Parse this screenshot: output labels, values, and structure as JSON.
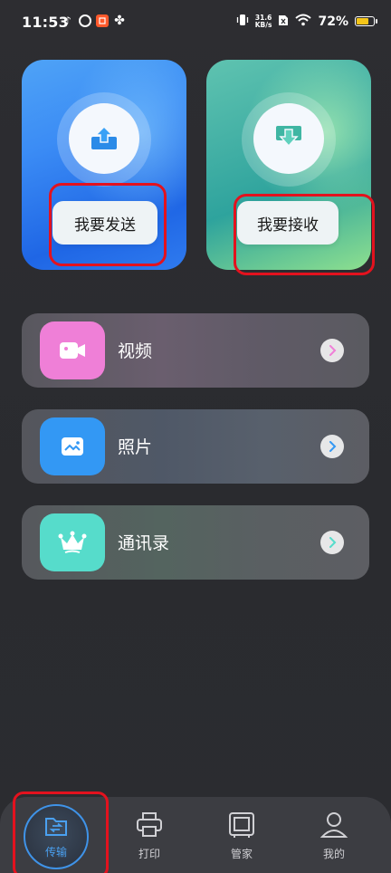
{
  "status_bar": {
    "time": "11:53",
    "network_speed_value": "31.6",
    "network_speed_unit": "KB/s",
    "battery_text": "72%",
    "battery_level": 0.72,
    "battery_color": "#f5c518"
  },
  "cards": {
    "send": {
      "label": "我要发送",
      "icon": "upload-icon"
    },
    "receive": {
      "label": "我要接收",
      "icon": "download-icon"
    }
  },
  "list": [
    {
      "label": "视频",
      "icon": "video-camera-icon",
      "color": "#ef7fd7"
    },
    {
      "label": "照片",
      "icon": "photo-icon",
      "color": "#3398f4"
    },
    {
      "label": "通讯录",
      "icon": "crown-icon",
      "color": "#56dccb"
    }
  ],
  "nav": {
    "items": [
      {
        "label": "传输",
        "icon": "folder-transfer-icon",
        "active": true
      },
      {
        "label": "打印",
        "icon": "printer-icon",
        "active": false
      },
      {
        "label": "管家",
        "icon": "monitor-icon",
        "active": false
      },
      {
        "label": "我的",
        "icon": "person-icon",
        "active": false
      }
    ],
    "active_color": "#4aa0f0"
  },
  "highlight_color": "#e3121e"
}
